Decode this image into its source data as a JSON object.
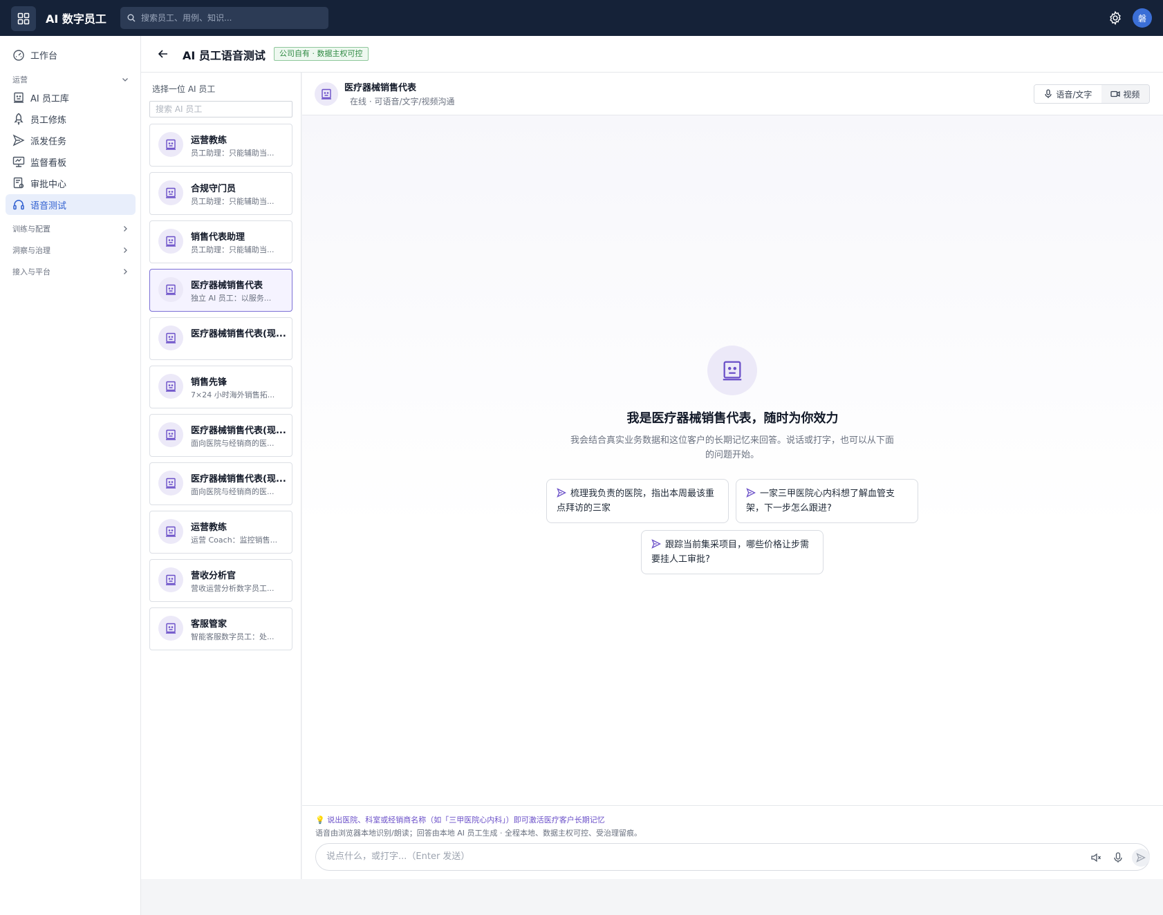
{
  "app": {
    "title": "AI 数字员工",
    "search_placeholder": "搜索员工、用例、知识...",
    "avatar_text": "磐"
  },
  "sidebar": {
    "top_item": "工作台",
    "group_ops": "运营",
    "items": [
      {
        "label": "AI 员工库",
        "icon": "robot-icon"
      },
      {
        "label": "员工修炼",
        "icon": "rocket-icon"
      },
      {
        "label": "派发任务",
        "icon": "send-icon"
      },
      {
        "label": "监督看板",
        "icon": "monitor-icon"
      },
      {
        "label": "审批中心",
        "icon": "approval-icon"
      },
      {
        "label": "语音测试",
        "icon": "headset-icon",
        "active": true
      }
    ],
    "groups": [
      "训练与配置",
      "洞察与治理",
      "接入与平台"
    ]
  },
  "page": {
    "title": "AI 员工语音测试",
    "badge": "公司自有 · 数据主权可控"
  },
  "employee_panel": {
    "label": "选择一位 AI 员工",
    "search_placeholder": "搜索 AI 员工",
    "employees": [
      {
        "name": "运营教练",
        "desc": "员工助理：只能辅助当..."
      },
      {
        "name": "合规守门员",
        "desc": "员工助理：只能辅助当..."
      },
      {
        "name": "销售代表助理",
        "desc": "员工助理：只能辅助当..."
      },
      {
        "name": "医疗器械销售代表",
        "desc": "独立 AI 员工：以服务...",
        "selected": true
      },
      {
        "name": "医疗器械销售代表(现...",
        "desc": ""
      },
      {
        "name": "销售先锋",
        "desc": "7×24 小时海外销售拓..."
      },
      {
        "name": "医疗器械销售代表(现...",
        "desc": "面向医院与经销商的医..."
      },
      {
        "name": "医疗器械销售代表(现...",
        "desc": "面向医院与经销商的医..."
      },
      {
        "name": "运营教练",
        "desc": "运营 Coach：监控销售..."
      },
      {
        "name": "营收分析官",
        "desc": "营收运营分析数字员工..."
      },
      {
        "name": "客服管家",
        "desc": "智能客服数字员工：处..."
      }
    ]
  },
  "chat": {
    "name": "医疗器械销售代表",
    "status": "在线 · 可语音/文字/视频沟通",
    "mode_voice": "语音/文字",
    "mode_video": "视频",
    "hero_title": "我是医疗器械销售代表，随时为你效力",
    "hero_sub": "我会结合真实业务数据和这位客户的长期记忆来回答。说话或打字，也可以从下面的问题开始。",
    "suggestions": [
      "梳理我负责的医院，指出本周最该重点拜访的三家",
      "一家三甲医院心内科想了解血管支架，下一步怎么跟进?",
      "跟踪当前集采项目，哪些价格让步需要挂人工审批?"
    ],
    "tip": "💡 说出医院、科室或经销商名称（如「三甲医院心内科」）即可激活医疗客户长期记忆",
    "note": "语音由浏览器本地识别/朗读；回答由本地 AI 员工生成 · 全程本地、数据主权可控、受治理留痕。",
    "input_placeholder": "说点什么，或打字...（Enter 发送）"
  },
  "colors": {
    "topbar": "#152238",
    "accent": "#2f5fd0",
    "purple": "#6a4fc8",
    "badge_green": "#2f8a43"
  }
}
